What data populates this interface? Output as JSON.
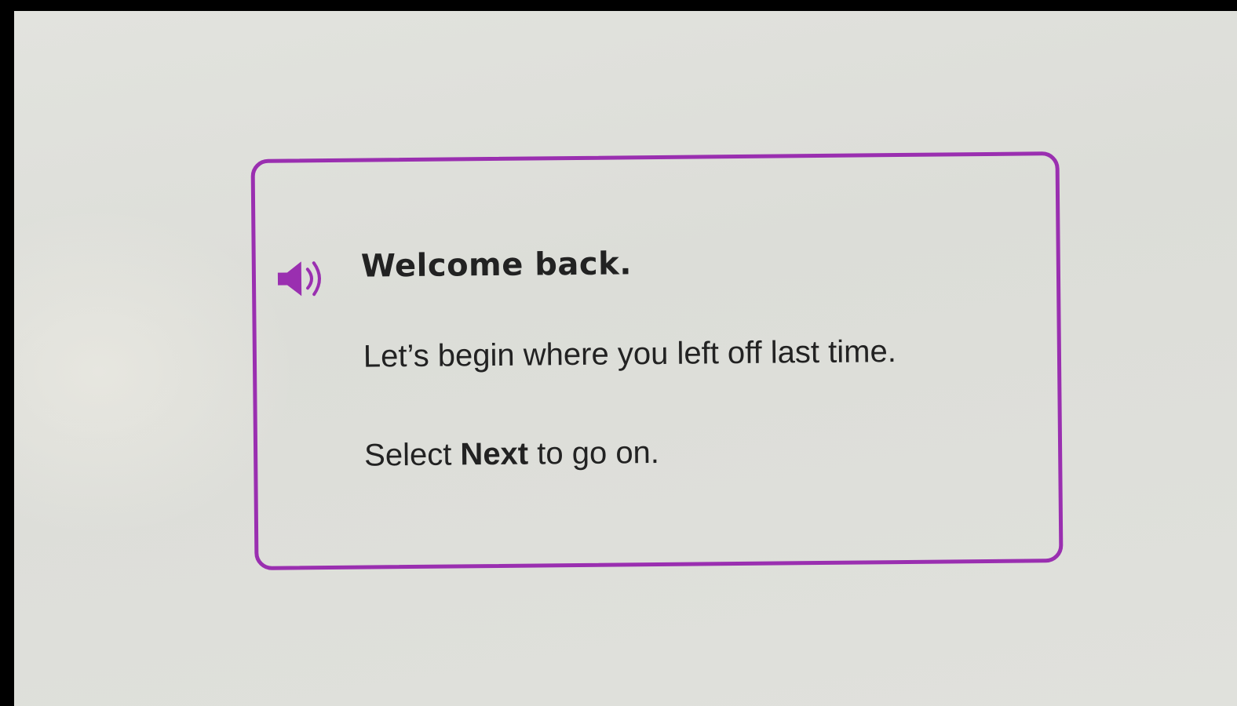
{
  "dialog": {
    "accent_color": "#9a2fb0",
    "speaker_icon": "speaker-audio-icon",
    "title": "Welcome back.",
    "message": "Let’s begin where you left off last time.",
    "instruction": {
      "prefix": "Select ",
      "keyword": "Next",
      "suffix": " to go on."
    }
  }
}
